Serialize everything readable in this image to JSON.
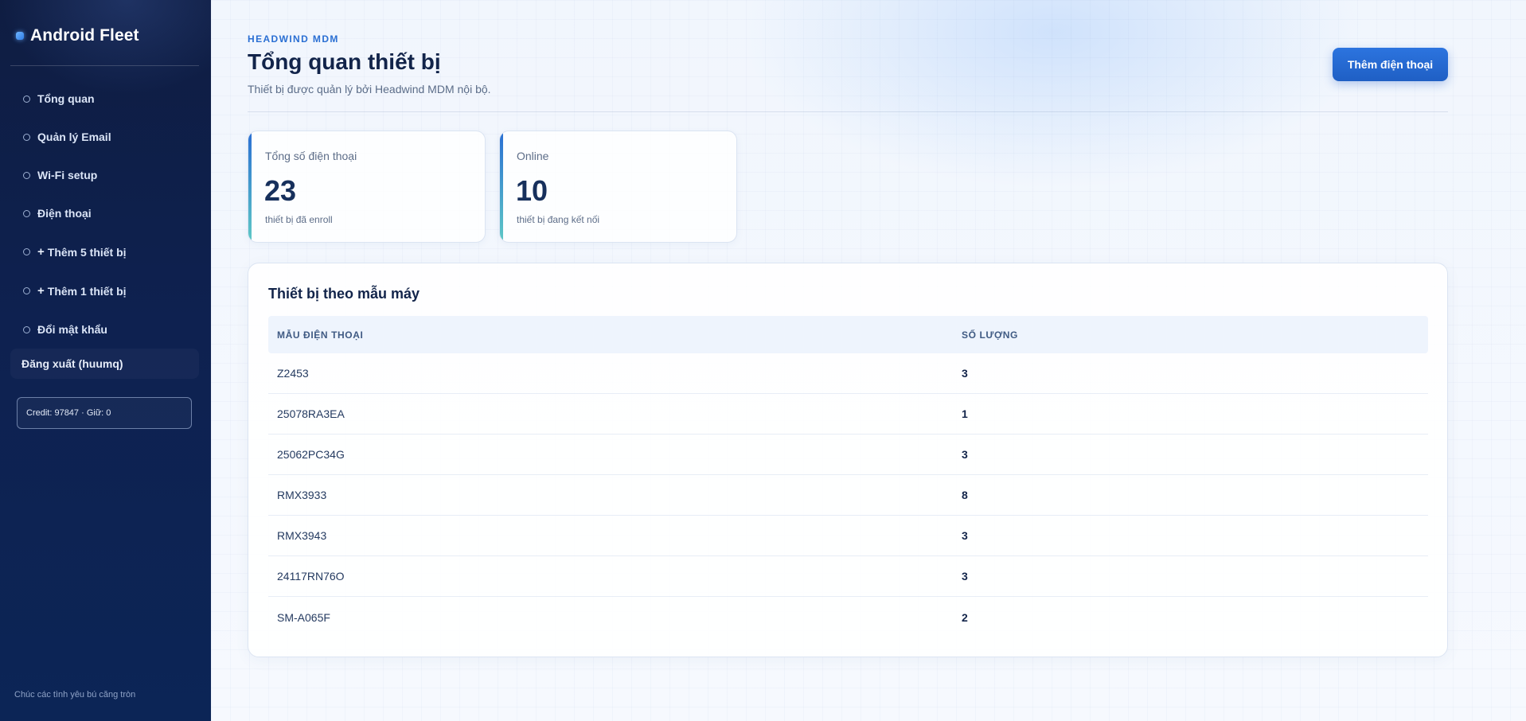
{
  "sidebar": {
    "brand": "Android Fleet",
    "items": [
      {
        "label": "Tổng quan",
        "plus": ""
      },
      {
        "label": "Quản lý Email",
        "plus": ""
      },
      {
        "label": "Wi-Fi setup",
        "plus": ""
      },
      {
        "label": "Điện thoại",
        "plus": ""
      },
      {
        "label": "Thêm 5 thiết bị",
        "plus": "+"
      },
      {
        "label": "Thêm 1 thiết bị",
        "plus": "+"
      },
      {
        "label": "Đổi mật khẩu",
        "plus": ""
      }
    ],
    "logout": "Đăng xuất (huumq)",
    "credit": "Credit: 97847 · Giữ: 0",
    "footer": "Chúc các tình yêu bú căng tròn"
  },
  "header": {
    "eyebrow": "HEADWIND MDM",
    "title": "Tổng quan thiết bị",
    "subtitle": "Thiết bị được quản lý bởi Headwind MDM nội bộ.",
    "add_button": "Thêm điện thoại"
  },
  "stats": [
    {
      "label": "Tổng số điện thoại",
      "value": "23",
      "note": "thiết bị đã enroll"
    },
    {
      "label": "Online",
      "value": "10",
      "note": "thiết bị đang kết nối"
    }
  ],
  "panel": {
    "title": "Thiết bị theo mẫu máy",
    "columns": [
      "MẪU ĐIỆN THOẠI",
      "SỐ LƯỢNG"
    ],
    "rows": [
      {
        "model": "Z2453",
        "count": "3"
      },
      {
        "model": "25078RA3EA",
        "count": "1"
      },
      {
        "model": "25062PC34G",
        "count": "3"
      },
      {
        "model": "RMX3933",
        "count": "8"
      },
      {
        "model": "RMX3943",
        "count": "3"
      },
      {
        "model": "24117RN76O",
        "count": "3"
      },
      {
        "model": "SM-A065F",
        "count": "2"
      }
    ]
  },
  "colors": {
    "sidebar_bg": "#0f1d42",
    "accent": "#2a6fd3",
    "stat_accent_end": "#5ec8c6"
  }
}
